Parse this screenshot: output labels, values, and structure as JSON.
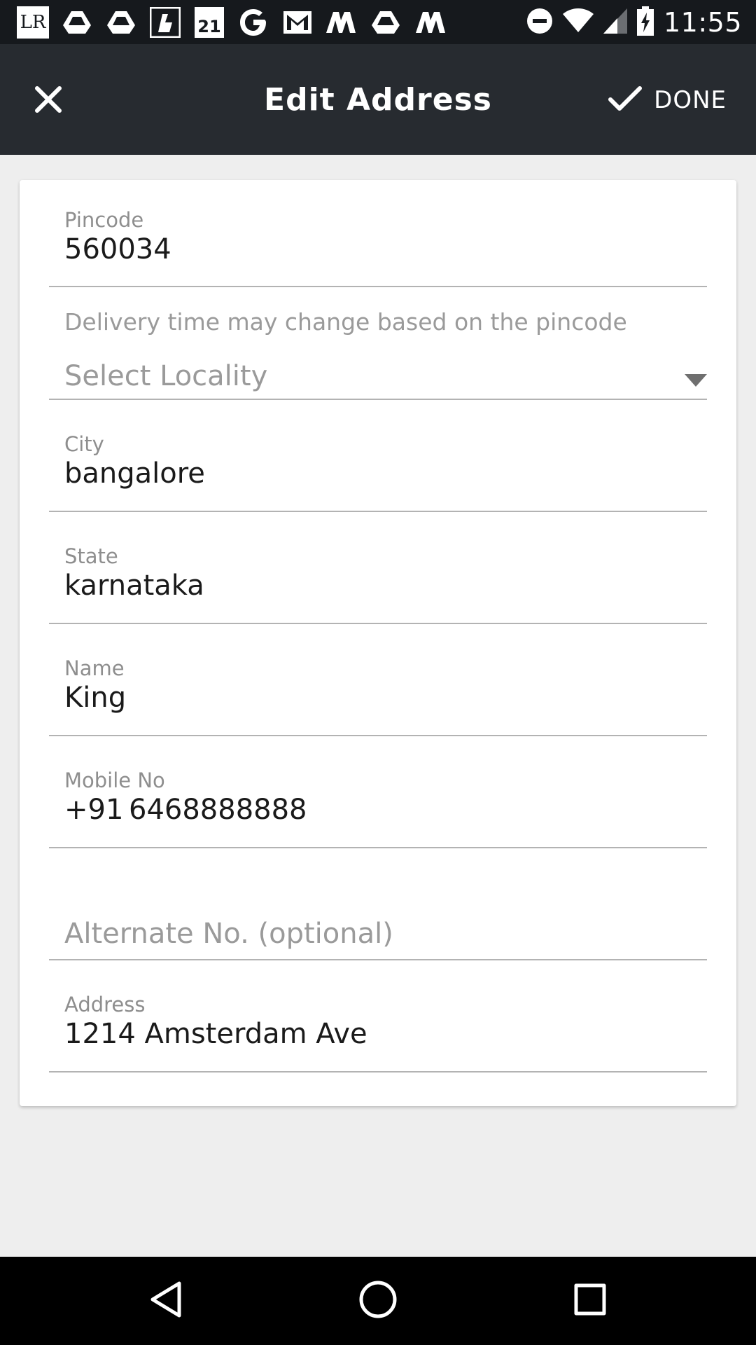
{
  "status_bar": {
    "time": "11:55",
    "notification_icons": [
      "lr-icon",
      "drive-icon",
      "drive-icon",
      "app-icon",
      "forever21-icon",
      "google-icon",
      "gmail-icon",
      "m-icon",
      "drive-icon",
      "m-icon"
    ],
    "forever21_text": "21",
    "lr_text": "LR"
  },
  "app_bar": {
    "title": "Edit Address",
    "done_label": "DONE"
  },
  "form": {
    "pincode": {
      "label": "Pincode",
      "value": "560034"
    },
    "helper_text": "Delivery time may change based on the pincode",
    "locality": {
      "placeholder": "Select Locality"
    },
    "city": {
      "label": "City",
      "value": "bangalore"
    },
    "state": {
      "label": "State",
      "value": "karnataka"
    },
    "name": {
      "label": "Name",
      "value": "King"
    },
    "mobile": {
      "label": "Mobile No",
      "prefix": "+91",
      "value": "6468888888"
    },
    "alternate": {
      "placeholder": "Alternate No. (optional)"
    },
    "address": {
      "label": "Address",
      "value": "1214 Amsterdam Ave"
    }
  },
  "colors": {
    "status_bar": "#16191d",
    "app_bar": "#272b30",
    "background": "#eeeeee",
    "card": "#ffffff"
  }
}
